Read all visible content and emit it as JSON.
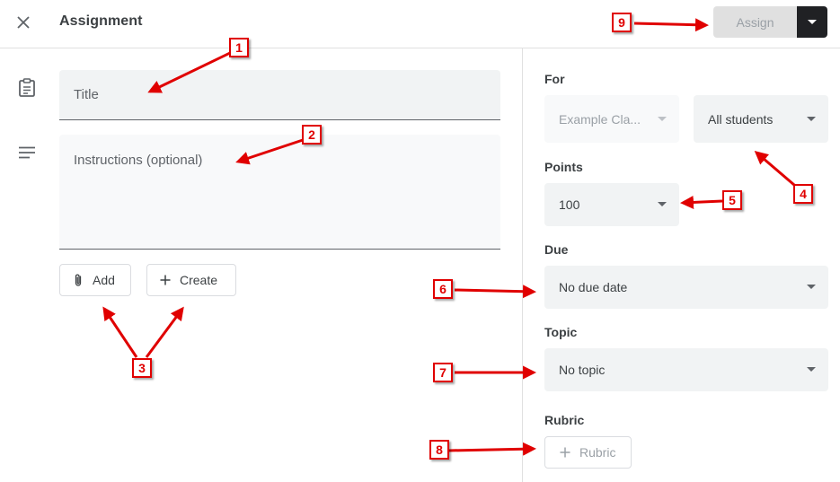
{
  "header": {
    "title": "Assignment",
    "assign_label": "Assign"
  },
  "form": {
    "title_placeholder": "Title",
    "instructions_placeholder": "Instructions (optional)",
    "add_label": "Add",
    "create_label": "Create"
  },
  "side": {
    "for_label": "For",
    "class_value": "Example Cla...",
    "students_value": "All students",
    "points_label": "Points",
    "points_value": "100",
    "due_label": "Due",
    "due_value": "No due date",
    "topic_label": "Topic",
    "topic_value": "No topic",
    "rubric_label": "Rubric",
    "rubric_button": "Rubric"
  },
  "annotations": [
    "1",
    "2",
    "3",
    "4",
    "5",
    "6",
    "7",
    "8",
    "9"
  ],
  "colors": {
    "annotation": "#e00000",
    "assign_disabled_bg": "#e0e0e0",
    "caret_bg": "#202124",
    "field_bg": "#f1f3f4"
  }
}
